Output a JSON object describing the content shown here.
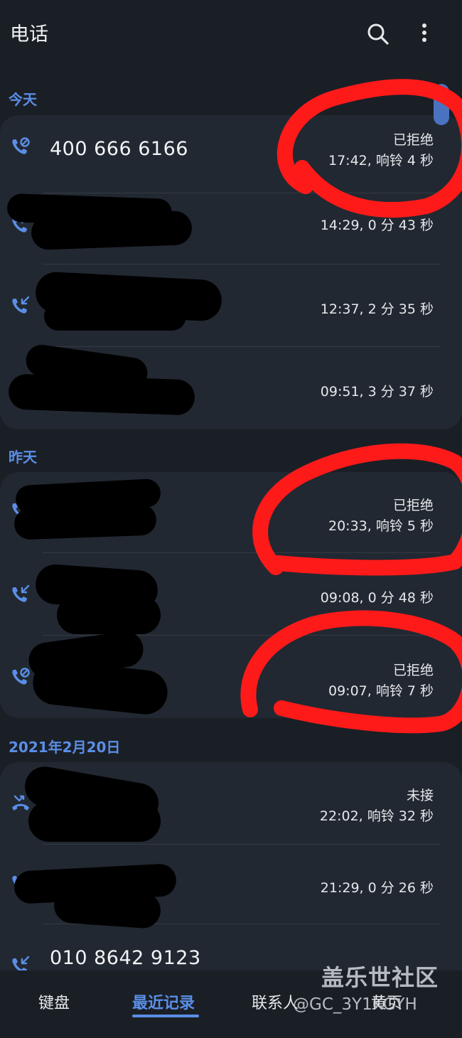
{
  "app_bar": {
    "title": "电话",
    "search_icon": "search-icon",
    "more_icon": "more-vertical-icon"
  },
  "sections": [
    {
      "header": "今天",
      "calls": [
        {
          "name": "400 666 6166",
          "icon": "call-rejected-icon",
          "status": "已拒绝",
          "detail": "17:42, 响铃 4 秒"
        },
        {
          "name": "",
          "icon": "call-outgoing-icon",
          "status": "",
          "detail": "14:29, 0 分 43 秒"
        },
        {
          "name": "",
          "icon": "call-incoming-icon",
          "status": "",
          "detail": "12:37, 2 分 35 秒"
        },
        {
          "name": "",
          "icon": "call-incoming-icon",
          "status": "",
          "detail": "09:51, 3 分 37 秒"
        }
      ]
    },
    {
      "header": "昨天",
      "calls": [
        {
          "name": "",
          "icon": "call-rejected-icon",
          "status": "已拒绝",
          "detail": "20:33, 响铃 5 秒"
        },
        {
          "name": "",
          "icon": "call-incoming-icon",
          "status": "",
          "detail": "09:08, 0 分 48 秒"
        },
        {
          "name": "",
          "icon": "call-rejected-icon",
          "status": "已拒绝",
          "detail": "09:07, 响铃 7 秒"
        }
      ]
    },
    {
      "header": "2021年2月20日",
      "calls": [
        {
          "name": "",
          "icon": "call-missed-icon",
          "status": "未接",
          "detail": "22:02, 响铃 32 秒"
        },
        {
          "name": "",
          "icon": "call-outgoing-icon",
          "status": "",
          "detail": "21:29, 0 分 26 秒"
        },
        {
          "name": "010 8642 9123",
          "icon": "call-incoming-icon",
          "status": "",
          "detail": ""
        }
      ]
    }
  ],
  "bottom_nav": {
    "tabs": [
      "键盘",
      "最近记录",
      "联系人",
      "黄页"
    ],
    "active_index": 1
  },
  "watermark": {
    "site": "盖乐世社区",
    "user": "@GC_3Y1KGYH"
  },
  "colors": {
    "background": "#1a1f26",
    "card": "#222831",
    "accent": "#5b8ee6",
    "annotation": "#ff1a1a"
  }
}
